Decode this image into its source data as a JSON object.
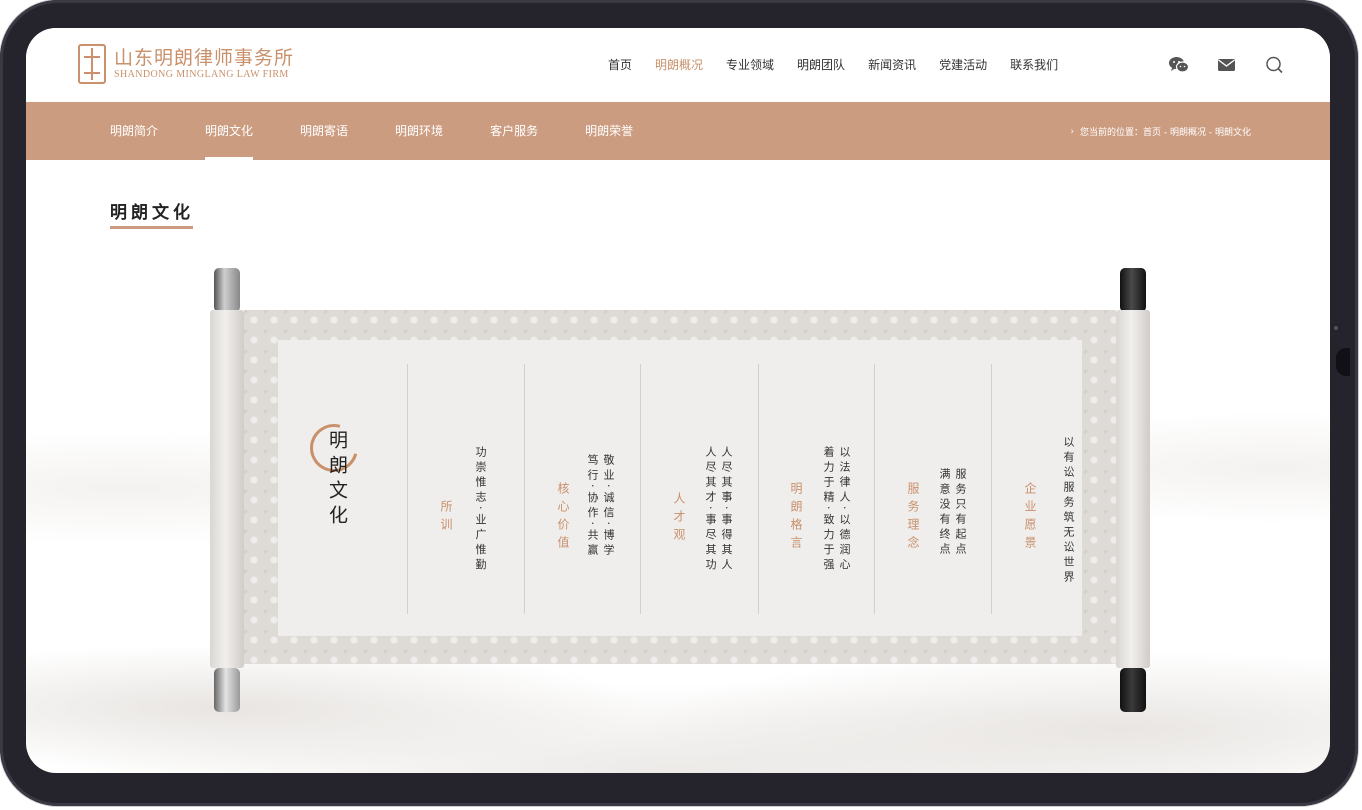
{
  "brand": {
    "name_cn": "山东明朗律师事务所",
    "name_en": "SHANDONG MINGLANG LAW FIRM",
    "accent_color": "#c9906a",
    "subnav_color": "#cc9c80"
  },
  "nav": {
    "items": [
      "首页",
      "明朗概况",
      "专业领域",
      "明朗团队",
      "新闻资讯",
      "党建活动",
      "联系我们"
    ],
    "active": "明朗概况"
  },
  "header_icons": [
    "wechat-icon",
    "mail-icon",
    "search-icon"
  ],
  "subnav": {
    "items": [
      "明朗简介",
      "明朗文化",
      "明朗寄语",
      "明朗环境",
      "客户服务",
      "明朗荣誉"
    ],
    "active": "明朗文化"
  },
  "breadcrumb": {
    "text": "您当前的位置：首页 - 明朗概况 - 明朗文化"
  },
  "section": {
    "title": "明朗文化"
  },
  "scroll": {
    "emblem": "明朗文化",
    "columns": [
      {
        "title": "所训",
        "lines": [
          "功崇惟志·业广惟勤"
        ]
      },
      {
        "title": "核心价值",
        "lines": [
          "敬业·诚信·博学",
          "笃行·协作·共赢"
        ]
      },
      {
        "title": "人才观",
        "lines": [
          "人尽其事·事得其人",
          "人尽其才·事尽其功"
        ]
      },
      {
        "title": "明朗格言",
        "lines": [
          "以法律人·以德润心",
          "着力于精·致力于强"
        ]
      },
      {
        "title": "服务理念",
        "lines": [
          "服务只有起点",
          "满意没有终点"
        ]
      },
      {
        "title": "企业愿景",
        "lines": [
          "以有讼服务筑无讼世界"
        ]
      }
    ]
  }
}
